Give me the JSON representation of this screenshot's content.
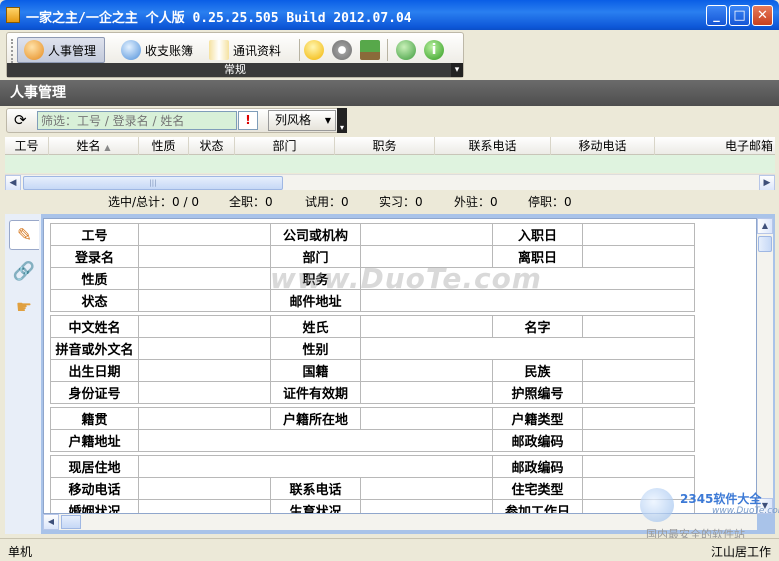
{
  "window": {
    "title": "一家之主/一企之主 个人版 0.25.25.505 Build 2012.07.04"
  },
  "toolbar": {
    "buttons": [
      {
        "label": "人事管理",
        "icon": "people-icon"
      },
      {
        "label": "收支账簿",
        "icon": "coin-icon"
      },
      {
        "label": "通讯资料",
        "icon": "book-icon"
      }
    ],
    "icon_buttons": [
      "lightbulb-icon",
      "gear-icon",
      "sign-icon",
      "globe-download-icon",
      "info-icon"
    ],
    "group_label": "常规"
  },
  "section": {
    "title": "人事管理"
  },
  "filter": {
    "placeholder": "筛选：工号 / 登录名 / 姓名",
    "clear_label": "!",
    "column_style_label": "列风格"
  },
  "grid": {
    "columns": [
      "工号",
      "姓名",
      "性质",
      "状态",
      "部门",
      "职务",
      "联系电话",
      "移动电话",
      "电子邮箱"
    ],
    "sort_indicator": "▲"
  },
  "summary": {
    "selected_total": "选中/总计：0 / 0",
    "fulltime": "全职：0",
    "probation": "试用：0",
    "intern": "实习：0",
    "outsourced": "外驻：0",
    "suspended": "停职：0"
  },
  "form": {
    "rows1": [
      [
        "工号",
        "公司或机构",
        "入职日"
      ],
      [
        "登录名",
        "部门",
        "离职日"
      ],
      [
        "性质",
        "职务",
        ""
      ],
      [
        "状态",
        "邮件地址",
        ""
      ]
    ],
    "rows2": [
      [
        "中文姓名",
        "姓氏",
        "名字"
      ],
      [
        "拼音或外文名",
        "性别",
        ""
      ],
      [
        "出生日期",
        "国籍",
        "民族"
      ],
      [
        "身份证号",
        "证件有效期",
        "护照编号"
      ]
    ],
    "rows3": [
      [
        "籍贯",
        "户籍所在地",
        "户籍类型"
      ],
      [
        "户籍地址",
        "",
        "邮政编码"
      ]
    ],
    "rows4": [
      [
        "现居住地",
        "",
        "邮政编码"
      ],
      [
        "移动电话",
        "联系电话",
        "住宅类型"
      ],
      [
        "婚姻状况",
        "生育状况",
        "参加工作日"
      ]
    ]
  },
  "watermark": {
    "center": "www.DuoTe.com",
    "brand": "2345软件大全",
    "url": "www.DuoTe.com",
    "slogan": "国内最安全的软件站"
  },
  "statusbar": {
    "left": "单机",
    "right": "江山居工作"
  }
}
